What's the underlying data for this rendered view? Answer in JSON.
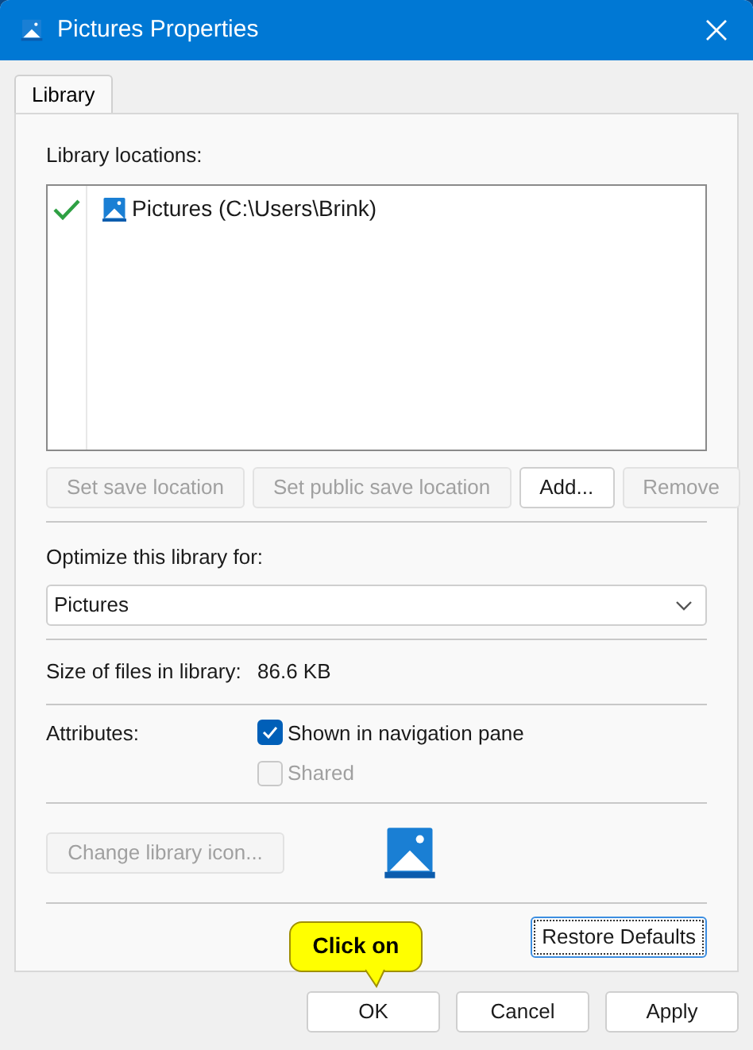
{
  "window": {
    "title": "Pictures Properties"
  },
  "tabs": [
    {
      "label": "Library",
      "selected": true
    }
  ],
  "locations": {
    "label": "Library locations:",
    "items": [
      {
        "name": "Pictures (C:\\Users\\Brink)",
        "default_save": true
      }
    ]
  },
  "location_buttons": [
    {
      "label": "Set save location",
      "disabled": true
    },
    {
      "label": "Set public save location",
      "disabled": true
    },
    {
      "label": "Add...",
      "disabled": false
    },
    {
      "label": "Remove",
      "disabled": true
    }
  ],
  "optimize": {
    "label": "Optimize this library for:",
    "value": "Pictures"
  },
  "size": {
    "label": "Size of files in library:",
    "value": "86.6 KB"
  },
  "attributes": {
    "label": "Attributes:",
    "options": [
      {
        "label": "Shown in navigation pane",
        "checked": true,
        "disabled": false
      },
      {
        "label": "Shared",
        "checked": false,
        "disabled": true
      }
    ]
  },
  "change_icon_button": {
    "label": "Change library icon...",
    "disabled": true
  },
  "restore_button": {
    "label": "Restore Defaults",
    "focused": true
  },
  "callout": {
    "text": "Click on"
  },
  "footer_buttons": [
    {
      "label": "OK",
      "disabled": false
    },
    {
      "label": "Cancel",
      "disabled": false
    },
    {
      "label": "Apply",
      "disabled": false
    }
  ]
}
